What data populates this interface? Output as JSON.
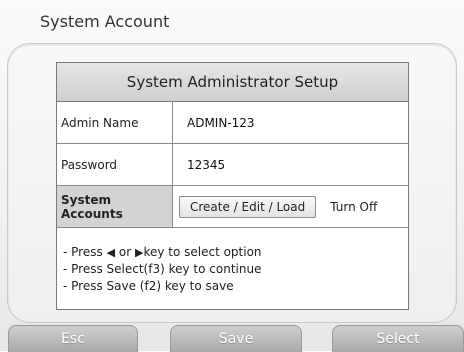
{
  "window": {
    "title": "System Account"
  },
  "setup": {
    "header": "System Administrator Setup",
    "rows": [
      {
        "label": "Admin Name",
        "value": "ADMIN-123"
      },
      {
        "label": "Password",
        "value": "12345"
      }
    ],
    "accounts": {
      "label": "System Accounts",
      "button": "Create / Edit / Load",
      "status": "Turn Off"
    },
    "instructions": {
      "line1_a": "- Press",
      "line1_or": "or",
      "line1_b": "key to select option",
      "line2": "- Press Select(f3) key to continue",
      "line3": "- Press Save (f2) key to save"
    }
  },
  "softkeys": {
    "esc": "Esc",
    "save": "Save",
    "select": "Select"
  }
}
